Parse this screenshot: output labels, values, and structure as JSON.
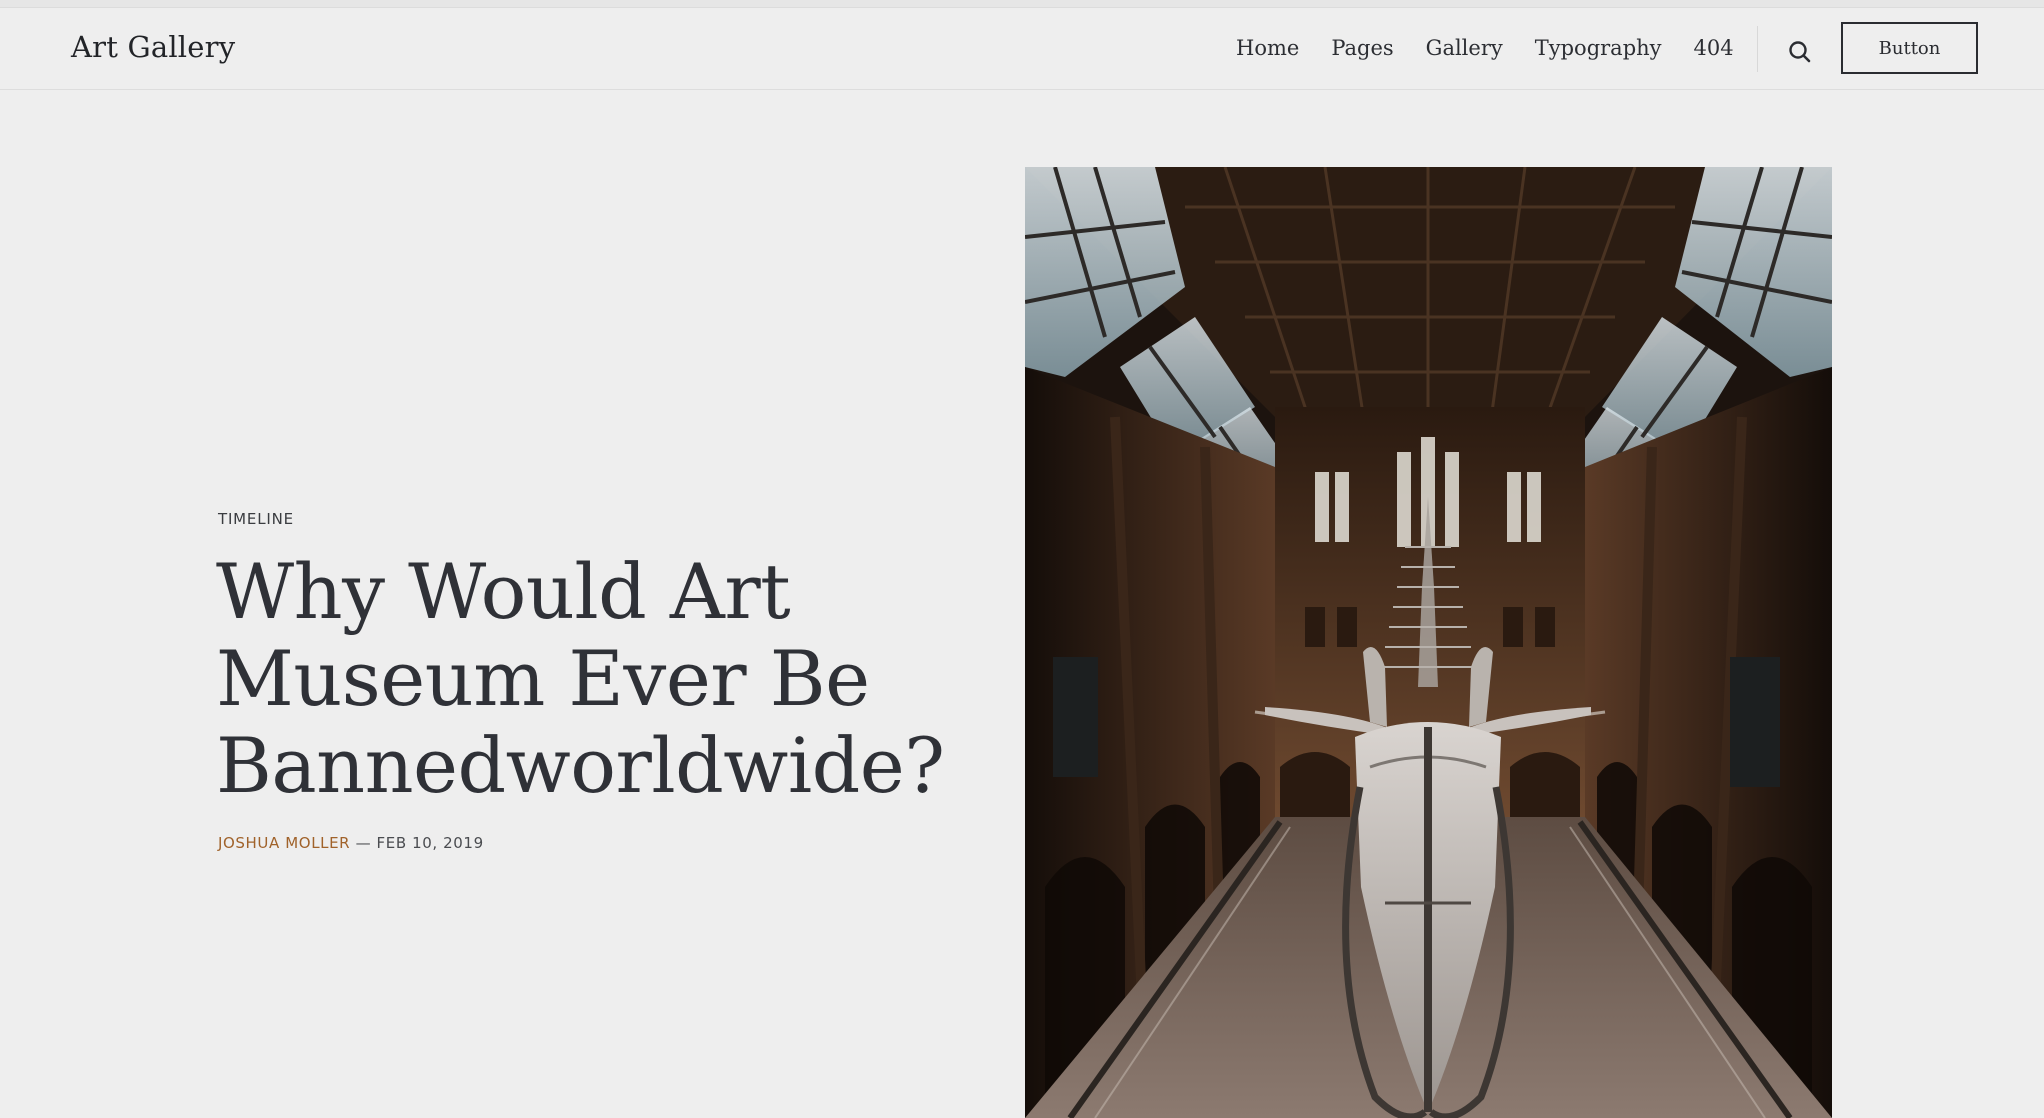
{
  "header": {
    "brand": "Art Gallery",
    "nav": [
      {
        "label": "Home"
      },
      {
        "label": "Pages"
      },
      {
        "label": "Gallery"
      },
      {
        "label": "Typography"
      },
      {
        "label": "404"
      }
    ],
    "search_icon": "search-icon",
    "button_label": "Button"
  },
  "post": {
    "category": "TIMELINE",
    "title": "Why Would Art Museum Ever Be Bannedworldwide?",
    "author": "JOSHUA MOLLER",
    "date": "— FEB 10, 2019"
  },
  "colors": {
    "background": "#eeeeee",
    "text": "#2f3137",
    "author": "#a0622a"
  }
}
